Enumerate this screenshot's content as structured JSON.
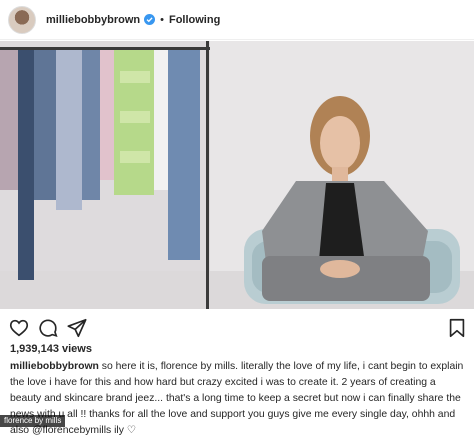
{
  "header": {
    "username": "milliebobbybrown",
    "separator": "•",
    "follow_status": "Following"
  },
  "icons": {
    "verified": "verified-badge-icon",
    "like": "heart-icon",
    "comment": "comment-icon",
    "share": "share-icon",
    "save": "bookmark-icon",
    "tags": "user-tag-icon"
  },
  "stats": {
    "views": "1,939,143 views"
  },
  "caption": {
    "username": "milliebobbybrown",
    "text": " so here it is, florence by mills. literally the love of my life, i cant begin to explain the love i have for this and how hard but crazy excited i was to create it. 2 years of creating a beauty and skincare brand jeez... that's a long time to keep a secret but now i can finally share the news with u all !! thanks for all the love and support you guys give me every single day, ohhh and also @florencebymills ily ♡"
  },
  "watermark": "florence by mills",
  "colors": {
    "verified": "#3897f0",
    "text": "#262626"
  }
}
